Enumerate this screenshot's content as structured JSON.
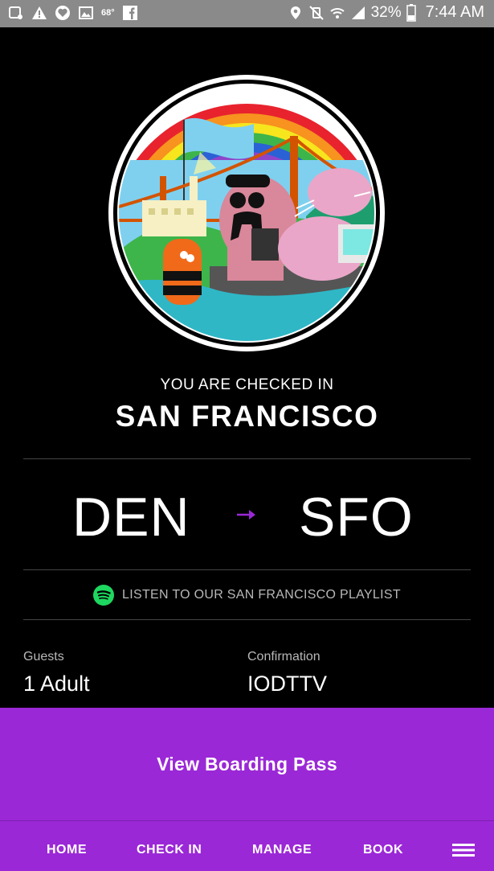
{
  "status_bar": {
    "temperature": "68°",
    "battery": "32%",
    "time": "7:44 AM",
    "icons": [
      "notification-icon",
      "warning-icon",
      "heart-app-icon",
      "image-icon",
      "facebook-icon",
      "location-icon",
      "mute-icon",
      "wifi-icon",
      "signal-icon",
      "battery-icon"
    ]
  },
  "badge": {
    "icon": "san-francisco-illustration"
  },
  "checkin": {
    "status_label": "YOU ARE CHECKED IN",
    "city": "SAN FRANCISCO"
  },
  "route": {
    "origin": "DEN",
    "destination": "SFO",
    "arrow_color": "#9b28d6"
  },
  "playlist": {
    "icon": "spotify-icon",
    "label": "LISTEN TO OUR SAN FRANCISCO PLAYLIST"
  },
  "booking": {
    "guests_label": "Guests",
    "guests_value": "1 Adult",
    "confirmation_label": "Confirmation",
    "confirmation_value": "IODTTV"
  },
  "boarding_button": {
    "label": "View Boarding Pass"
  },
  "nav": {
    "items": [
      "HOME",
      "CHECK IN",
      "MANAGE",
      "BOOK"
    ],
    "menu_icon": "hamburger-menu-icon"
  },
  "colors": {
    "accent": "#9b28d6",
    "spotify": "#1ed760",
    "background": "#000000"
  }
}
